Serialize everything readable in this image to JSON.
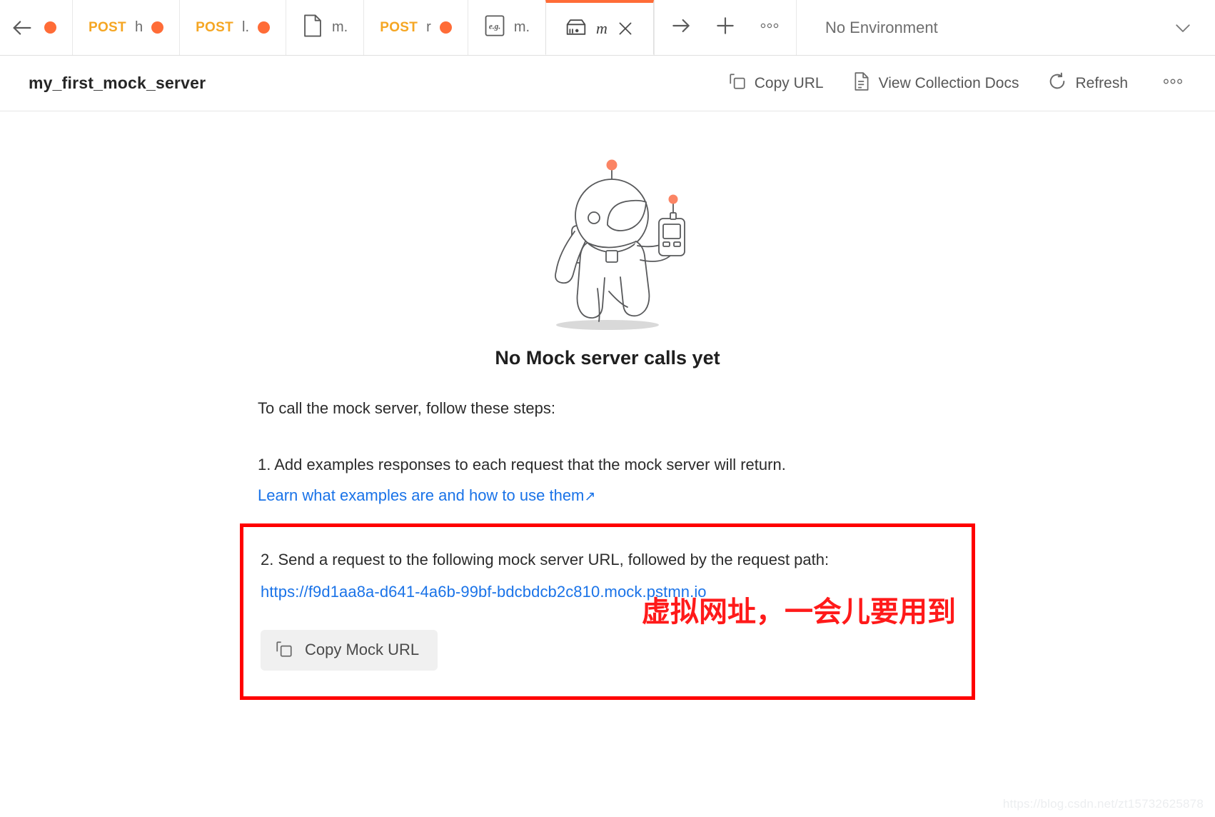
{
  "tabbar": {
    "back_icon": "arrow-left-icon",
    "tabs": [
      {
        "id": "t0",
        "kind": "dot-only",
        "method": "",
        "label": "",
        "unsaved": true
      },
      {
        "id": "t1",
        "kind": "request",
        "method": "POST",
        "label": "h",
        "unsaved": true
      },
      {
        "id": "t2",
        "kind": "request",
        "method": "POST",
        "label": "l.",
        "unsaved": true
      },
      {
        "id": "t3",
        "kind": "collection",
        "method": "",
        "label": "m.",
        "unsaved": false,
        "icon": "collection-icon"
      },
      {
        "id": "t4",
        "kind": "request",
        "method": "POST",
        "label": "r",
        "unsaved": true
      },
      {
        "id": "t5",
        "kind": "example",
        "method": "",
        "label": "m.",
        "unsaved": false,
        "icon": "example-icon"
      }
    ],
    "active_tab": {
      "title": "m",
      "icon": "mock-server-icon",
      "close_icon": "close-icon"
    },
    "actions": [
      {
        "name": "forward-arrow-icon",
        "glyph": "arrow-right-icon"
      },
      {
        "name": "new-tab-icon",
        "glyph": "plus-icon"
      },
      {
        "name": "tab-more-icon",
        "glyph": "ellipsis-icon"
      }
    ],
    "environment": {
      "selected": "No Environment",
      "caret_icon": "chevron-down-icon"
    }
  },
  "subheader": {
    "server_name": "my_first_mock_server",
    "actions": [
      {
        "id": "copy-url",
        "label": "Copy URL",
        "icon": "copy-icon"
      },
      {
        "id": "view-collection-docs",
        "label": "View Collection Docs",
        "icon": "document-icon"
      },
      {
        "id": "refresh",
        "label": "Refresh",
        "icon": "refresh-icon"
      }
    ],
    "more_icon": "ellipsis-icon"
  },
  "main": {
    "illustration_name": "astronaut-with-radio-illustration",
    "empty_title": "No Mock server calls yet",
    "intro": "To call the mock server, follow these steps:",
    "step_one": {
      "text": "1. Add examples responses to each request that the mock server will return.",
      "link_text": "Learn what examples are and how to use them",
      "link_arrow": "↗"
    },
    "step_two": {
      "text": "2. Send a request to the following mock server URL, followed by the request path:",
      "url": "https://f9d1aa8a-d641-4a6b-99bf-bdcbdcb2c810.mock.pstmn.io",
      "copy_button_label": "Copy Mock URL",
      "copy_button_icon": "copy-icon",
      "annotation_text": "虚拟网址，一会儿要用到",
      "annotation_color": "#ff1a1a",
      "highlight_box_color": "#ff0000"
    }
  },
  "watermark": "https://blog.csdn.net/zt15732625878",
  "colors": {
    "accent_orange": "#ff6c37",
    "method_post": "#f5a623",
    "link_blue": "#1a73e8",
    "annotation_red": "#ff0000",
    "text_primary": "#262626",
    "text_secondary": "#6b6b6b"
  }
}
